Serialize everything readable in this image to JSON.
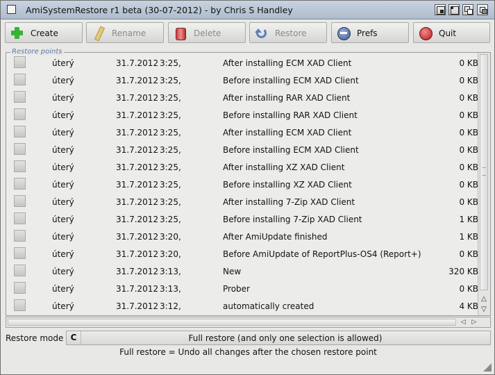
{
  "window": {
    "title": "AmiSystemRestore r1 beta (30-07-2012) - by Chris S Handley"
  },
  "toolbar": {
    "create_label": "Create",
    "create_icon": "plus-icon",
    "rename_label": "Rename",
    "rename_icon": "pencil-icon",
    "delete_label": "Delete",
    "delete_icon": "trash-icon",
    "restore_label": "Restore",
    "restore_icon": "restore-icon",
    "prefs_label": "Prefs",
    "prefs_icon": "prefs-icon",
    "quit_label": "Quit",
    "quit_icon": "quit-icon"
  },
  "restore_points": {
    "label": "Restore points",
    "rows": [
      {
        "day": "úterý",
        "date": "31.7.2012",
        "time": "3:25,",
        "desc": "After installing ECM XAD Client",
        "size": "0 KB"
      },
      {
        "day": "úterý",
        "date": "31.7.2012",
        "time": "3:25,",
        "desc": "Before installing ECM XAD Client",
        "size": "0 KB"
      },
      {
        "day": "úterý",
        "date": "31.7.2012",
        "time": "3:25,",
        "desc": "After installing RAR XAD Client",
        "size": "0 KB"
      },
      {
        "day": "úterý",
        "date": "31.7.2012",
        "time": "3:25,",
        "desc": "Before installing RAR XAD Client",
        "size": "0 KB"
      },
      {
        "day": "úterý",
        "date": "31.7.2012",
        "time": "3:25,",
        "desc": "After installing ECM XAD Client",
        "size": "0 KB"
      },
      {
        "day": "úterý",
        "date": "31.7.2012",
        "time": "3:25,",
        "desc": "Before installing ECM XAD Client",
        "size": "0 KB"
      },
      {
        "day": "úterý",
        "date": "31.7.2012",
        "time": "3:25,",
        "desc": "After installing XZ XAD Client",
        "size": "0 KB"
      },
      {
        "day": "úterý",
        "date": "31.7.2012",
        "time": "3:25,",
        "desc": "Before installing XZ XAD Client",
        "size": "0 KB"
      },
      {
        "day": "úterý",
        "date": "31.7.2012",
        "time": "3:25,",
        "desc": "After installing 7-Zip XAD Client",
        "size": "0 KB"
      },
      {
        "day": "úterý",
        "date": "31.7.2012",
        "time": "3:25,",
        "desc": "Before installing 7-Zip XAD Client",
        "size": "1 KB"
      },
      {
        "day": "úterý",
        "date": "31.7.2012",
        "time": "3:20,",
        "desc": "After AmiUpdate finished",
        "size": "1 KB"
      },
      {
        "day": "úterý",
        "date": "31.7.2012",
        "time": "3:20,",
        "desc": "Before AmiUpdate of ReportPlus-OS4 (Report+)",
        "size": "0 KB"
      },
      {
        "day": "úterý",
        "date": "31.7.2012",
        "time": "3:13,",
        "desc": "New",
        "size": "320 KB"
      },
      {
        "day": "úterý",
        "date": "31.7.2012",
        "time": "3:13,",
        "desc": "Prober",
        "size": "0 KB"
      },
      {
        "day": "úterý",
        "date": "31.7.2012",
        "time": "3:12,",
        "desc": "automatically created",
        "size": "4 KB"
      }
    ]
  },
  "restore_mode": {
    "label": "Restore mode",
    "value": "Full restore (and only one selection is allowed)",
    "description": "Full restore = Undo all changes after the chosen restore point"
  }
}
